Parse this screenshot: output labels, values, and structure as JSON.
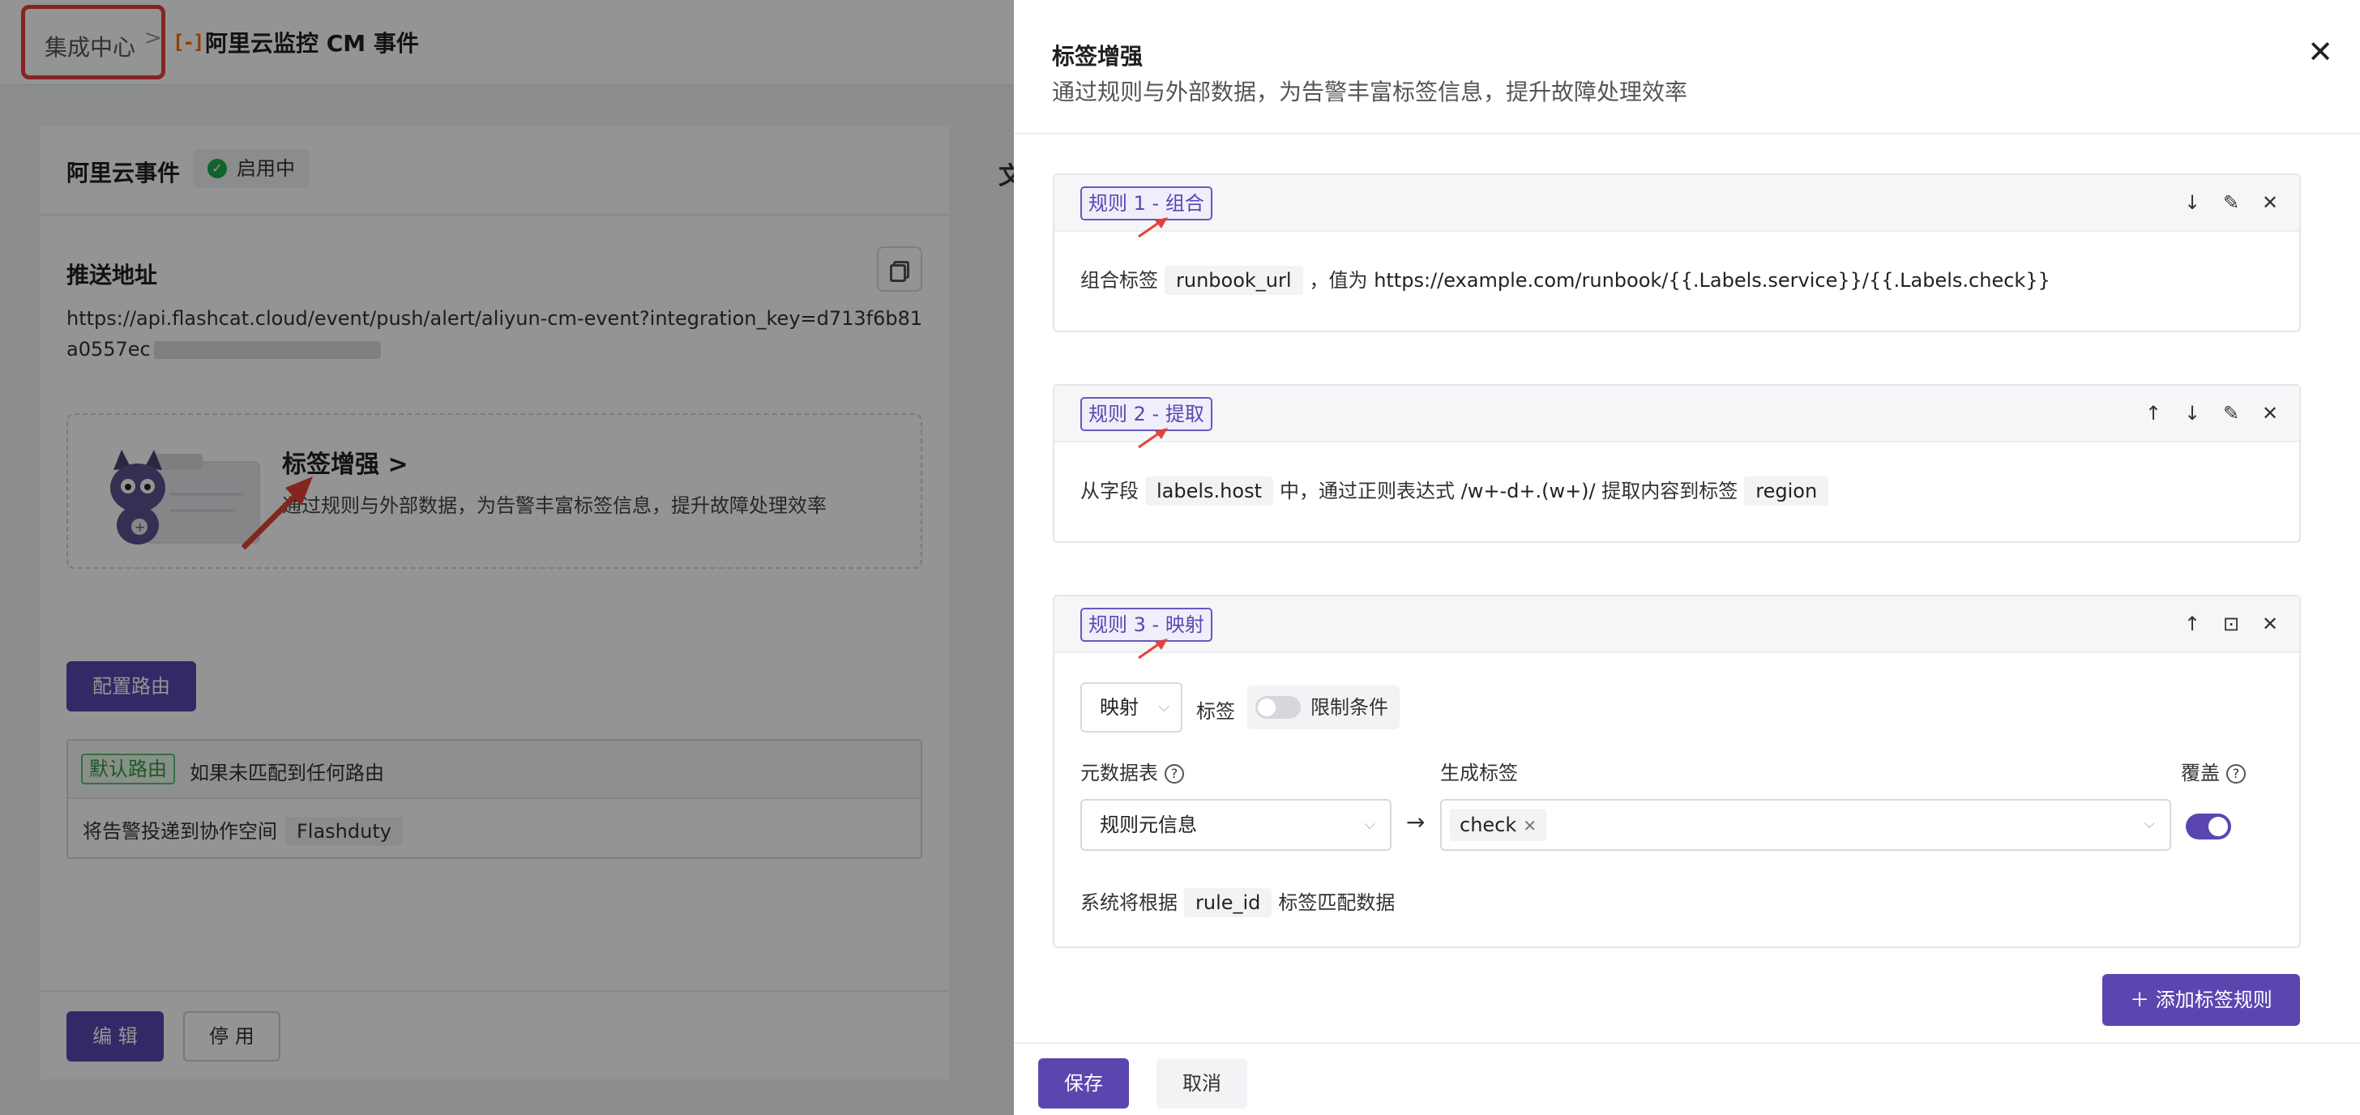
{
  "breadcrumb": {
    "root": "集成中心",
    "separator": ">",
    "current_icon": "aliyun-icon",
    "current_icon_glyph": "[-]",
    "current": "阿里云监控 CM 事件"
  },
  "integration": {
    "title": "阿里云事件",
    "status": "启用中",
    "push_label": "推送地址",
    "push_url": "https://api.flashcat.cloud/event/push/alert/aliyun-cm-event?integration_key=d713f6b81a0557ec",
    "promo_title": "标签增强",
    "promo_title_chevron": ">",
    "promo_desc": "通过规则与外部数据，为告警丰富标签信息，提升故障处理效率",
    "route_button": "配置路由",
    "default_route_tag": "默认路由",
    "default_route_text": "如果未匹配到任何路由",
    "deliver_text": "将告警投递到协作空间",
    "deliver_target": "Flashduty",
    "edit_button": "编 辑",
    "disable_button": "停 用",
    "peek_char": "文"
  },
  "drawer": {
    "title": "标签增强",
    "subtitle": "通过规则与外部数据，为告警丰富标签信息，提升故障处理效率",
    "close": "✕",
    "rules": [
      {
        "tag": "规则 1 - 组合",
        "body_prefix": "组合标签",
        "label": "runbook_url",
        "body_mid": "，值为",
        "value": "https://example.com/runbook/{{.Labels.service}}/{{.Labels.check}}"
      },
      {
        "tag": "规则 2 - 提取",
        "body_prefix": "从字段",
        "field": "labels.host",
        "body_mid": "中，通过正则表达式",
        "regex": "/w+-d+.(w+)/",
        "body_mid2": "提取内容到标签",
        "target": "region"
      },
      {
        "tag": "规则 3 - 映射",
        "mode": "映射",
        "label_word": "标签",
        "restrict": "限制条件",
        "meta_label": "元数据表",
        "meta_value": "规则元信息",
        "gen_label": "生成标签",
        "gen_chip": "check",
        "override_label": "覆盖",
        "override_on": true,
        "note_prefix": "系统将根据",
        "note_key": "rule_id",
        "note_suffix": "标签匹配数据"
      }
    ],
    "add_rule": "＋ 添加标签规则",
    "save": "保存",
    "cancel": "取消"
  },
  "colors": {
    "brand": "#5b46b0",
    "annotation": "#e5413b",
    "success": "#22a94b"
  }
}
